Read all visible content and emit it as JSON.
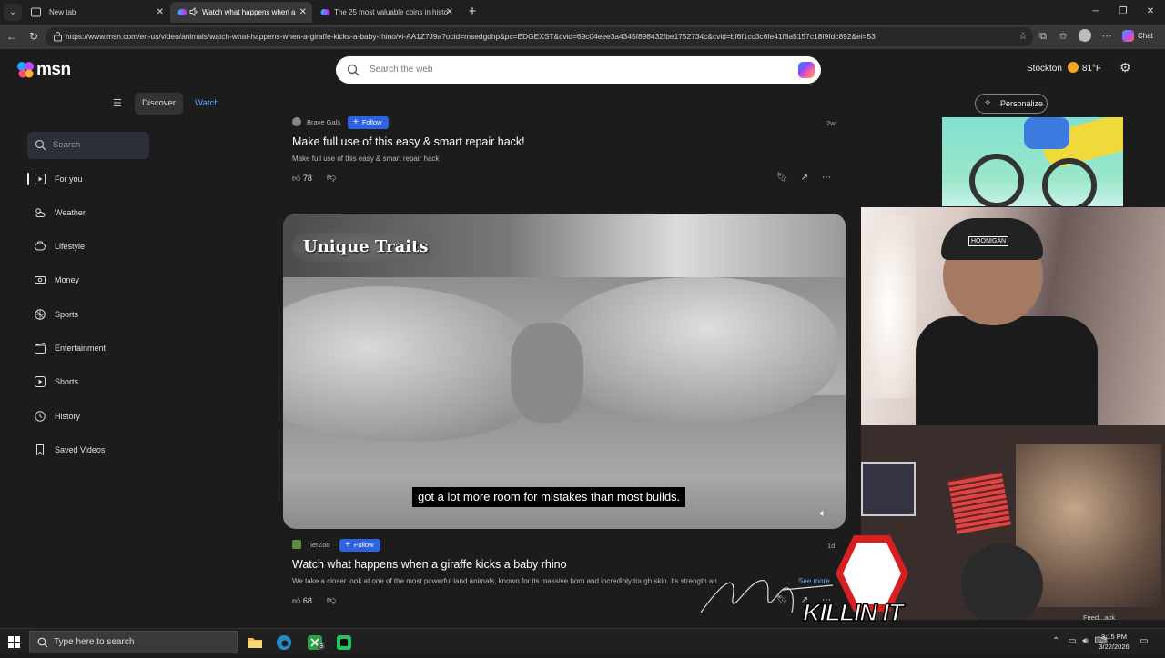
{
  "browser": {
    "tabs": [
      {
        "title": "New tab",
        "active": false
      },
      {
        "title": "Watch what happens when a",
        "active": true
      },
      {
        "title": "The 25 most valuable coins in histo",
        "active": false
      }
    ],
    "close_glyph": "✕",
    "new_tab_glyph": "+",
    "url": "https://www.msn.com/en-us/video/animals/watch-what-happens-when-a-giraffe-kicks-a-baby-rhino/vi-AA1Z7J9a?ocid=msedgdhp&pc=EDGEXST&cvid=69c04eee3a4345f898432fbe1752734c&cvid=bf6f1cc3c6fe41f8a5157c18f9fdc892&ei=53",
    "chat_label": "Chat",
    "window_controls": {
      "minimize": "─",
      "restore": "❐",
      "close": "✕"
    }
  },
  "msn": {
    "logo_text": "msn",
    "search_placeholder": "Search the web",
    "weather": {
      "city": "Stockton",
      "temp": "81°F"
    },
    "nav": {
      "discover": "Discover",
      "watch": "Watch"
    },
    "personalize_label": "Personalize",
    "sidebar": {
      "search_placeholder": "Search",
      "items": [
        {
          "label": "For you",
          "icon": "play-square-icon",
          "active": true
        },
        {
          "label": "Weather",
          "icon": "weather-icon",
          "active": false
        },
        {
          "label": "Lifestyle",
          "icon": "lifestyle-icon",
          "active": false
        },
        {
          "label": "Money",
          "icon": "money-icon",
          "active": false
        },
        {
          "label": "Sports",
          "icon": "sports-icon",
          "active": false
        },
        {
          "label": "Entertainment",
          "icon": "entertainment-icon",
          "active": false
        },
        {
          "label": "Shorts",
          "icon": "shorts-icon",
          "active": false
        },
        {
          "label": "History",
          "icon": "history-icon",
          "active": false
        },
        {
          "label": "Saved Videos",
          "icon": "bookmark-icon",
          "active": false
        }
      ]
    },
    "cards": [
      {
        "source": "Brave Gals",
        "follow_label": "Follow",
        "age": "2w",
        "title": "Make full use of this easy & smart repair hack!",
        "description": "Make full use of this easy & smart repair hack",
        "likes": "78"
      },
      {
        "source": "TierZoo",
        "follow_label": "Follow",
        "age": "1d",
        "title": "Watch what happens when a giraffe kicks a baby rhino",
        "description": "We take a closer look at one of the most powerful land animals, known for its massive horn and incredibly tough skin. Its strength an...",
        "see_more": "See more",
        "likes": "68"
      }
    ],
    "video": {
      "overlay_title": "Unique Traits",
      "caption": "got a lot more room for mistakes than most builds."
    },
    "webcam_cap_text": "HOONIGAN",
    "brand_logo_text": "KILLIN IT",
    "feedback_label": "Feed...ack"
  },
  "taskbar": {
    "search_placeholder": "Type here to search",
    "xbox_badge": "3",
    "tray_icons": [
      "chevron-up-icon",
      "network-icon",
      "speaker-icon",
      "keyboard-icon"
    ],
    "time": "3:15 PM",
    "date": "3/22/2026"
  },
  "colors": {
    "accent_blue": "#2e63e0",
    "link_blue": "#6aa6ff",
    "page_bg": "#1c1c1c"
  }
}
